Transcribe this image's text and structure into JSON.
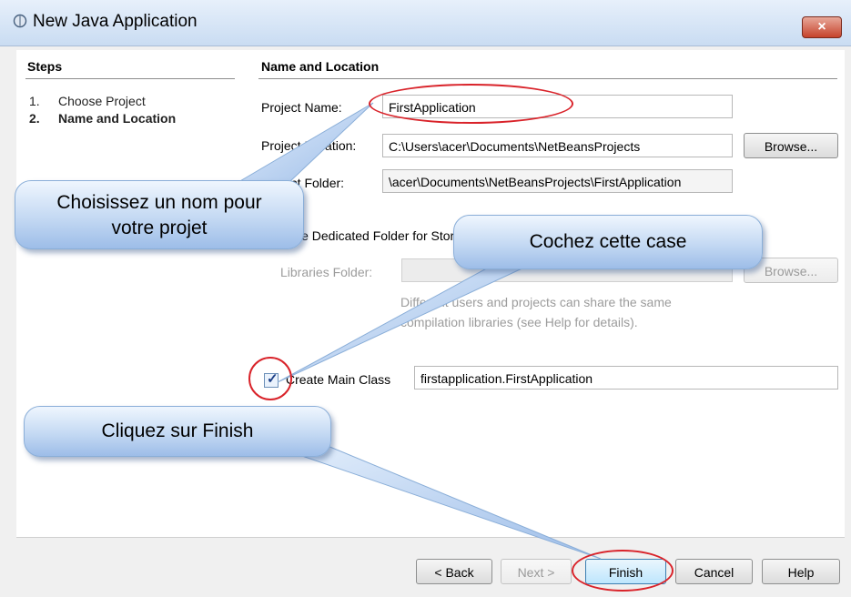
{
  "window": {
    "title": "New Java Application",
    "close_label": "×"
  },
  "steps": {
    "header": "Steps",
    "items": [
      {
        "num": "1.",
        "label": "Choose Project"
      },
      {
        "num": "2.",
        "label": "Name and Location"
      }
    ]
  },
  "main": {
    "header": "Name and Location",
    "project_name_label": "Project Name:",
    "project_name_value": "FirstApplication",
    "project_location_label": "Project Location:",
    "project_location_value": "C:\\Users\\acer\\Documents\\NetBeansProjects",
    "browse_label": "Browse...",
    "project_folder_label": "Project Folder:",
    "project_folder_value": "\\acer\\Documents\\NetBeansProjects\\FirstApplication",
    "dedicated_folder_label": "Use Dedicated Folder for Storing Libraries",
    "libraries_folder_label": "Libraries Folder:",
    "libraries_browse_label": "Browse...",
    "help_text_line1": "Different users and projects can share the same",
    "help_text_line2": "compilation libraries (see Help for details).",
    "create_main_class_label": "Create Main Class",
    "create_main_class_value": "firstapplication.FirstApplication",
    "create_main_class_checked": true
  },
  "footer": {
    "back_label": "< Back",
    "next_label": "Next >",
    "finish_label": "Finish",
    "cancel_label": "Cancel",
    "help_label": "Help"
  },
  "annotations": {
    "name_callout_line1": "Choisissez un nom pour",
    "name_callout_line2": "votre projet",
    "checkbox_callout": "Cochez cette case",
    "finish_callout": "Cliquez sur Finish"
  },
  "colors": {
    "highlight_red": "#d9232a",
    "callout_blue": "#c4d9f3",
    "titlebar": "#c9dcf2"
  }
}
